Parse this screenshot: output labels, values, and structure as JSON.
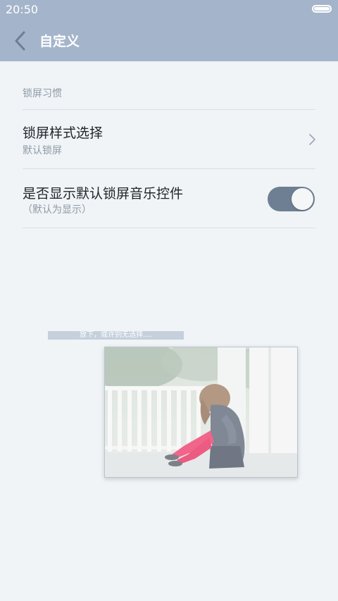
{
  "status_bar": {
    "time": "20:50"
  },
  "header": {
    "title": "自定义"
  },
  "section": {
    "title": "锁屏习惯"
  },
  "settings": [
    {
      "title": "锁屏样式选择",
      "subtitle": "默认锁屏"
    },
    {
      "title": "是否显示默认锁屏音乐控件",
      "subtitle": "（默认为显示）",
      "toggle_on": true
    }
  ],
  "drag_hint": "放下，或许别无选择....",
  "colors": {
    "header_bg": "#a4b5cb",
    "background": "#f0f4f7",
    "toggle_on": "#6f7f93",
    "tights": "#f0507a"
  },
  "icons": [
    "chevron-left-icon",
    "chevron-right-icon",
    "battery-icon"
  ]
}
